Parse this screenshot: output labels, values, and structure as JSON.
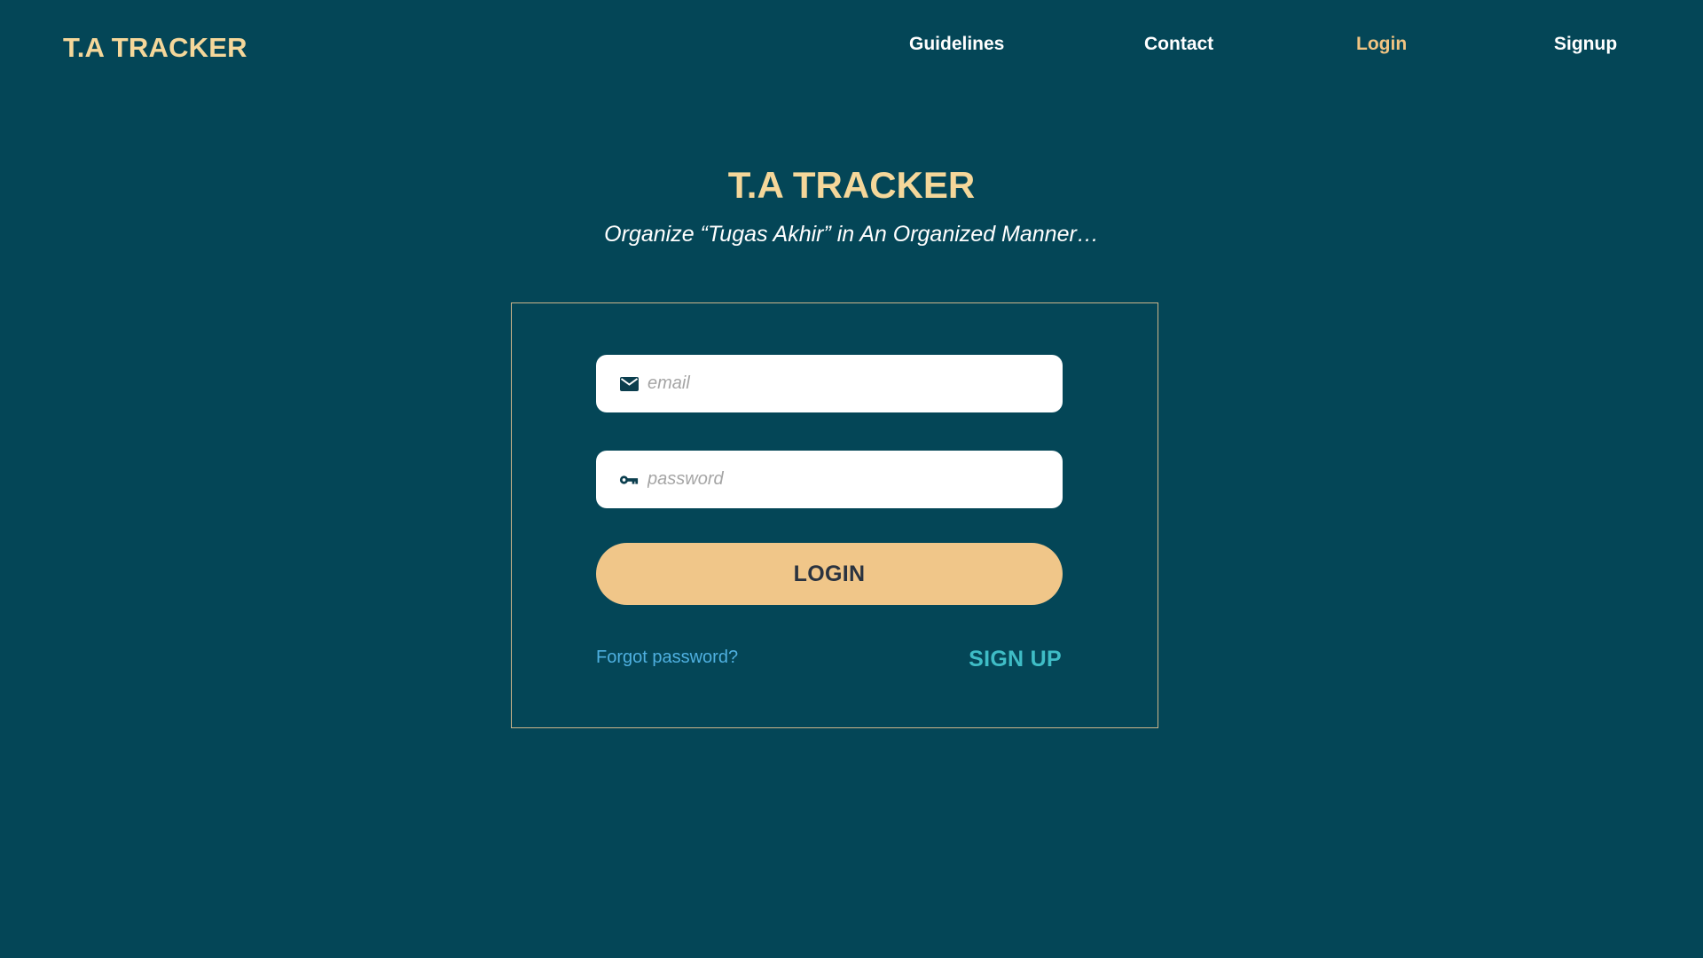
{
  "header": {
    "brand": "T.A TRACKER",
    "nav": {
      "guidelines": "Guidelines",
      "contact": "Contact",
      "login": "Login",
      "signup": "Signup"
    },
    "active_nav": "login"
  },
  "hero": {
    "title": "T.A TRACKER",
    "subtitle": "Organize “Tugas Akhir” in An Organized Manner…"
  },
  "login_form": {
    "email": {
      "icon": "mail-icon",
      "placeholder": "email",
      "value": ""
    },
    "password": {
      "icon": "key-icon",
      "placeholder": "password",
      "value": ""
    },
    "login_button": "LOGIN",
    "forgot_password": "Forgot password?",
    "sign_up": "SIGN UP"
  },
  "colors": {
    "background": "#044657",
    "brand_gold": "#F5D79A",
    "button_gold": "#F0C689",
    "link_blue": "#4FB0E0",
    "signup_teal": "#3FBDC6"
  }
}
